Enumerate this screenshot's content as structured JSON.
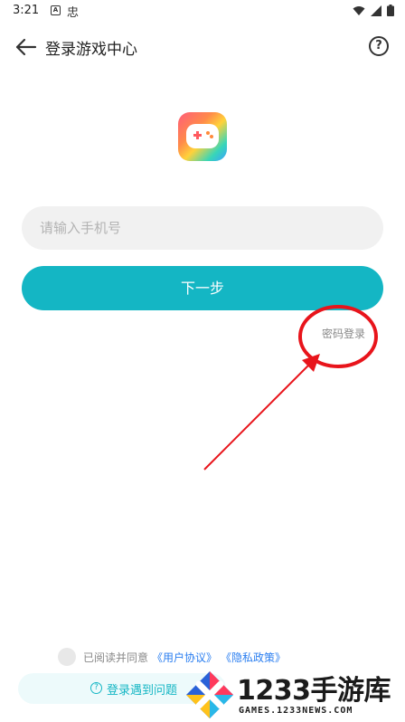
{
  "status_bar": {
    "time": "3:21",
    "icons": [
      "a-notification-icon",
      "bug-icon",
      "wifi-icon",
      "signal-icon",
      "battery-icon"
    ],
    "a_glyph": "A",
    "bug_glyph": "忠"
  },
  "header": {
    "title": "登录游戏中心",
    "back_icon": "arrow-left-icon",
    "help_glyph": "?"
  },
  "logo": {
    "icon": "gamepad-icon"
  },
  "form": {
    "phone_placeholder": "请输入手机号",
    "phone_value": "",
    "next_label": "下一步",
    "password_login_label": "密码登录"
  },
  "agreement": {
    "text": "已阅读并同意",
    "user_agreement": "《用户协议》",
    "privacy_policy": "《隐私政策》"
  },
  "login_help": {
    "label": "登录遇到问题",
    "icon_glyph": "?"
  },
  "watermark": {
    "title": "1233手游库",
    "subtitle": "GAMES.1233NEWS.COM"
  },
  "colors": {
    "accent": "#14b6c4",
    "link": "#2a7ef0",
    "annotation": "#e8141b"
  }
}
